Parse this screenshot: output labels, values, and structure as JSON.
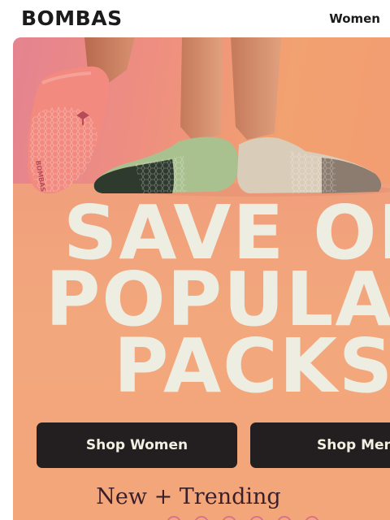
{
  "header": {
    "logo": "BOMBAS",
    "nav_women": "Women"
  },
  "hero": {
    "headline_line1": "SAVE ON",
    "headline_line2": "POPULAR",
    "headline_line3": "PACKS",
    "shop_women_label": "Shop Women",
    "shop_men_label": "Shop Men",
    "sock_brand_text": "BOMBAS"
  },
  "section": {
    "title": "New + Trending"
  },
  "colors": {
    "brand_dark": "#1b1b1b",
    "hero_peach": "#f3a47a",
    "headline_cream": "#eeede2",
    "button_dark": "#231f20",
    "sock_coral": "#f28a7f",
    "sock_green": "#a9c08f",
    "sock_beige": "#d9ccb8"
  }
}
